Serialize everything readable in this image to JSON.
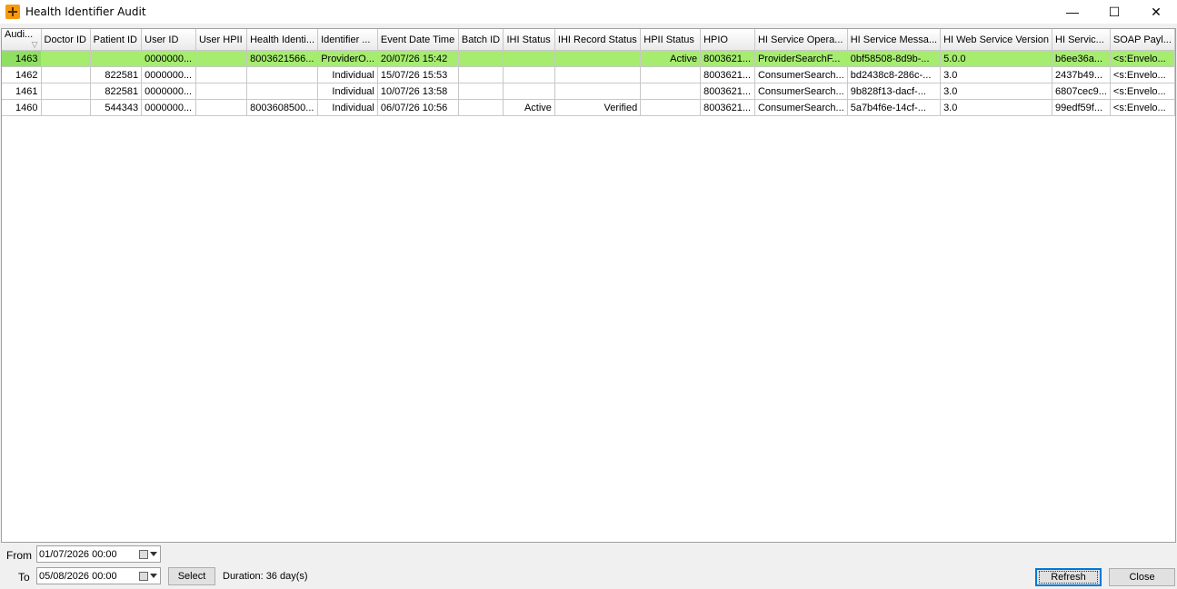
{
  "window": {
    "title": "Health Identifier Audit",
    "minimize": "—",
    "maximize": "☐",
    "close": "✕"
  },
  "grid": {
    "columns": [
      "Audi...",
      "Doctor ID",
      "Patient ID",
      "User ID",
      "User HPII",
      "Health Identi...",
      "Identifier ...",
      "Event Date Time",
      "Batch ID",
      "IHI Status",
      "IHI Record Status",
      "HPII Status",
      "HPIO",
      "HI Service Opera...",
      "HI Service Messa...",
      "HI Web Service Version",
      "HI Servic...",
      "SOAP Payl..."
    ],
    "sort_indicator": "▽",
    "rows": [
      [
        "1463",
        "",
        "",
        "0000000...",
        "",
        "8003621566...",
        "ProviderO...",
        "20/07/26 15:42",
        "",
        "",
        "",
        "Active",
        "8003621...",
        "ProviderSearchF...",
        "0bf58508-8d9b-...",
        "5.0.0",
        "b6ee36a...",
        "<s:Envelo..."
      ],
      [
        "1462",
        "",
        "822581",
        "0000000...",
        "",
        "",
        "Individual",
        "15/07/26 15:53",
        "",
        "",
        "",
        "",
        "8003621...",
        "ConsumerSearch...",
        "bd2438c8-286c-...",
        "3.0",
        "2437b49...",
        "<s:Envelo..."
      ],
      [
        "1461",
        "",
        "822581",
        "0000000...",
        "",
        "",
        "Individual",
        "10/07/26 13:58",
        "",
        "",
        "",
        "",
        "8003621...",
        "ConsumerSearch...",
        "9b828f13-dacf-...",
        "3.0",
        "6807cec9...",
        "<s:Envelo..."
      ],
      [
        "1460",
        "",
        "544343",
        "0000000...",
        "",
        "8003608500...",
        "Individual",
        "06/07/26 10:56",
        "",
        "Active",
        "Verified",
        "",
        "8003621...",
        "ConsumerSearch...",
        "5a7b4f6e-14cf-...",
        "3.0",
        "99edf59f...",
        "<s:Envelo..."
      ]
    ]
  },
  "filters": {
    "from_label": "From",
    "from_value": "01/07/2026 00:00",
    "to_label": "To",
    "to_value": "05/08/2026 00:00",
    "select_label": "Select",
    "duration_text": "Duration: 36 day(s)"
  },
  "actions": {
    "refresh_label": "Refresh",
    "close_label": "Close"
  },
  "colors": {
    "selected_row": "#a5ec6f",
    "accent": "#0078d7"
  }
}
